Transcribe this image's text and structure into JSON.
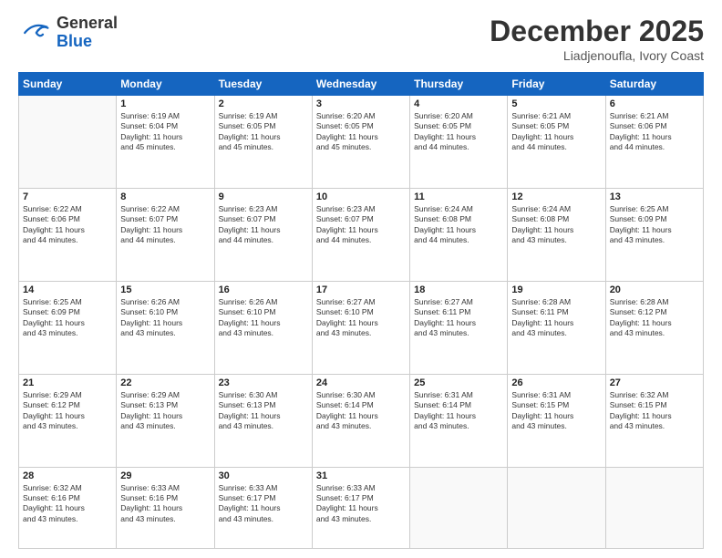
{
  "header": {
    "logo": {
      "general": "General",
      "blue": "Blue"
    },
    "title": "December 2025",
    "subtitle": "Liadjenoufla, Ivory Coast"
  },
  "days": [
    "Sunday",
    "Monday",
    "Tuesday",
    "Wednesday",
    "Thursday",
    "Friday",
    "Saturday"
  ],
  "weeks": [
    [
      {
        "day": "",
        "info": ""
      },
      {
        "day": "1",
        "info": "Sunrise: 6:19 AM\nSunset: 6:04 PM\nDaylight: 11 hours and 45 minutes."
      },
      {
        "day": "2",
        "info": "Sunrise: 6:19 AM\nSunset: 6:05 PM\nDaylight: 11 hours and 45 minutes."
      },
      {
        "day": "3",
        "info": "Sunrise: 6:20 AM\nSunset: 6:05 PM\nDaylight: 11 hours and 45 minutes."
      },
      {
        "day": "4",
        "info": "Sunrise: 6:20 AM\nSunset: 6:05 PM\nDaylight: 11 hours and 44 minutes."
      },
      {
        "day": "5",
        "info": "Sunrise: 6:21 AM\nSunset: 6:05 PM\nDaylight: 11 hours and 44 minutes."
      },
      {
        "day": "6",
        "info": "Sunrise: 6:21 AM\nSunset: 6:06 PM\nDaylight: 11 hours and 44 minutes."
      }
    ],
    [
      {
        "day": "7",
        "info": "Sunrise: 6:22 AM\nSunset: 6:06 PM\nDaylight: 11 hours and 44 minutes."
      },
      {
        "day": "8",
        "info": "Sunrise: 6:22 AM\nSunset: 6:07 PM\nDaylight: 11 hours and 44 minutes."
      },
      {
        "day": "9",
        "info": "Sunrise: 6:23 AM\nSunset: 6:07 PM\nDaylight: 11 hours and 44 minutes."
      },
      {
        "day": "10",
        "info": "Sunrise: 6:23 AM\nSunset: 6:07 PM\nDaylight: 11 hours and 44 minutes."
      },
      {
        "day": "11",
        "info": "Sunrise: 6:24 AM\nSunset: 6:08 PM\nDaylight: 11 hours and 44 minutes."
      },
      {
        "day": "12",
        "info": "Sunrise: 6:24 AM\nSunset: 6:08 PM\nDaylight: 11 hours and 43 minutes."
      },
      {
        "day": "13",
        "info": "Sunrise: 6:25 AM\nSunset: 6:09 PM\nDaylight: 11 hours and 43 minutes."
      }
    ],
    [
      {
        "day": "14",
        "info": "Sunrise: 6:25 AM\nSunset: 6:09 PM\nDaylight: 11 hours and 43 minutes."
      },
      {
        "day": "15",
        "info": "Sunrise: 6:26 AM\nSunset: 6:10 PM\nDaylight: 11 hours and 43 minutes."
      },
      {
        "day": "16",
        "info": "Sunrise: 6:26 AM\nSunset: 6:10 PM\nDaylight: 11 hours and 43 minutes."
      },
      {
        "day": "17",
        "info": "Sunrise: 6:27 AM\nSunset: 6:10 PM\nDaylight: 11 hours and 43 minutes."
      },
      {
        "day": "18",
        "info": "Sunrise: 6:27 AM\nSunset: 6:11 PM\nDaylight: 11 hours and 43 minutes."
      },
      {
        "day": "19",
        "info": "Sunrise: 6:28 AM\nSunset: 6:11 PM\nDaylight: 11 hours and 43 minutes."
      },
      {
        "day": "20",
        "info": "Sunrise: 6:28 AM\nSunset: 6:12 PM\nDaylight: 11 hours and 43 minutes."
      }
    ],
    [
      {
        "day": "21",
        "info": "Sunrise: 6:29 AM\nSunset: 6:12 PM\nDaylight: 11 hours and 43 minutes."
      },
      {
        "day": "22",
        "info": "Sunrise: 6:29 AM\nSunset: 6:13 PM\nDaylight: 11 hours and 43 minutes."
      },
      {
        "day": "23",
        "info": "Sunrise: 6:30 AM\nSunset: 6:13 PM\nDaylight: 11 hours and 43 minutes."
      },
      {
        "day": "24",
        "info": "Sunrise: 6:30 AM\nSunset: 6:14 PM\nDaylight: 11 hours and 43 minutes."
      },
      {
        "day": "25",
        "info": "Sunrise: 6:31 AM\nSunset: 6:14 PM\nDaylight: 11 hours and 43 minutes."
      },
      {
        "day": "26",
        "info": "Sunrise: 6:31 AM\nSunset: 6:15 PM\nDaylight: 11 hours and 43 minutes."
      },
      {
        "day": "27",
        "info": "Sunrise: 6:32 AM\nSunset: 6:15 PM\nDaylight: 11 hours and 43 minutes."
      }
    ],
    [
      {
        "day": "28",
        "info": "Sunrise: 6:32 AM\nSunset: 6:16 PM\nDaylight: 11 hours and 43 minutes."
      },
      {
        "day": "29",
        "info": "Sunrise: 6:33 AM\nSunset: 6:16 PM\nDaylight: 11 hours and 43 minutes."
      },
      {
        "day": "30",
        "info": "Sunrise: 6:33 AM\nSunset: 6:17 PM\nDaylight: 11 hours and 43 minutes."
      },
      {
        "day": "31",
        "info": "Sunrise: 6:33 AM\nSunset: 6:17 PM\nDaylight: 11 hours and 43 minutes."
      },
      {
        "day": "",
        "info": ""
      },
      {
        "day": "",
        "info": ""
      },
      {
        "day": "",
        "info": ""
      }
    ]
  ]
}
